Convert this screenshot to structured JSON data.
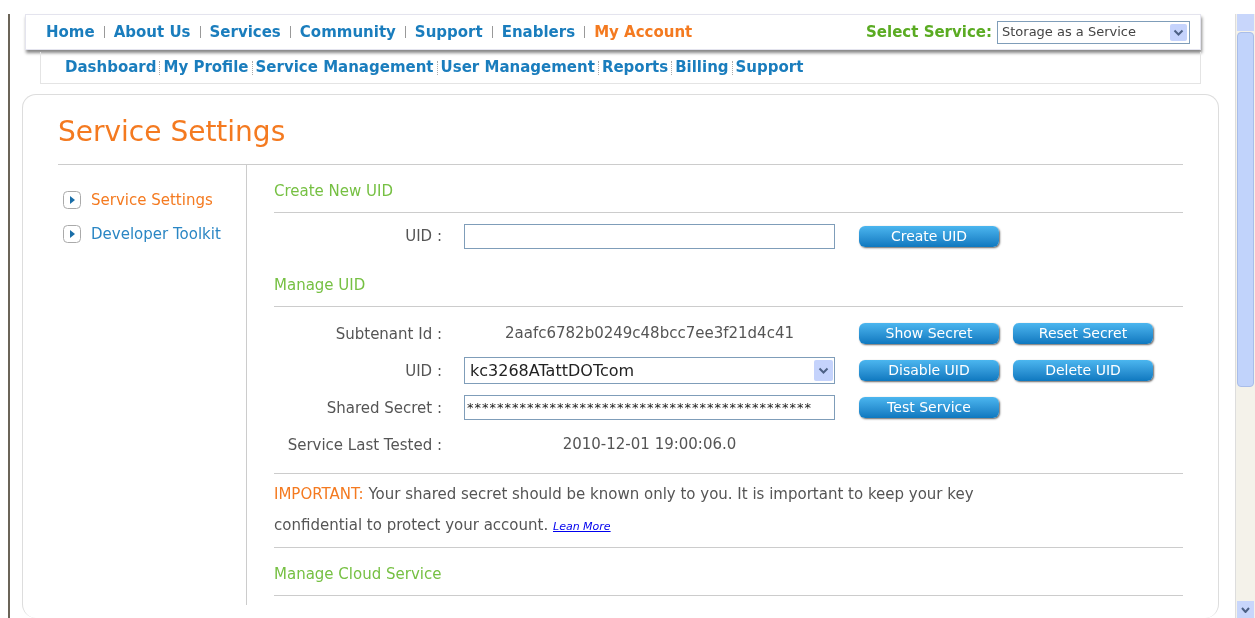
{
  "top_nav": {
    "items": [
      {
        "label": "Home",
        "selected": false
      },
      {
        "label": "About Us",
        "selected": false
      },
      {
        "label": "Services",
        "selected": false
      },
      {
        "label": "Community",
        "selected": false
      },
      {
        "label": "Support",
        "selected": false
      },
      {
        "label": "Enablers",
        "selected": false
      },
      {
        "label": "My Account",
        "selected": true
      }
    ],
    "service_select": {
      "label": "Select Service:",
      "value": "Storage as a Service"
    }
  },
  "sub_nav": {
    "items": [
      "Dashboard",
      "My Profile",
      "Service Management",
      "User Management",
      "Reports",
      "Billing",
      "Support"
    ]
  },
  "page_title": "Service Settings",
  "sidebar": {
    "items": [
      {
        "label": "Service Settings",
        "selected": true
      },
      {
        "label": "Developer Toolkit",
        "selected": false
      }
    ]
  },
  "create_uid": {
    "heading": "Create New UID",
    "field_label": "UID :",
    "button": "Create UID"
  },
  "manage_uid": {
    "heading": "Manage UID",
    "rows": [
      {
        "kind": "text",
        "label": "Subtenant Id :",
        "value": "2aafc6782b0249c48bcc7ee3f21d4c41",
        "buttons": [
          "Show Secret",
          "Reset Secret"
        ]
      },
      {
        "kind": "select",
        "label": "UID :",
        "value": "kc3268ATattDOTcom",
        "buttons": [
          "Disable UID",
          "Delete UID"
        ]
      },
      {
        "kind": "field",
        "label": "Shared Secret :",
        "value": "**********************************************",
        "buttons": [
          "Test Service"
        ]
      },
      {
        "kind": "text",
        "label": "Service Last Tested :",
        "value": "2010-12-01 19:00:06.0",
        "buttons": []
      }
    ]
  },
  "notice": {
    "label": "IMPORTANT:",
    "text": "Your shared secret should be known only to you. It is important to keep your key confidential to protect your account.",
    "link": "Lean More"
  },
  "cloud": {
    "heading": "Manage Cloud Service"
  }
}
